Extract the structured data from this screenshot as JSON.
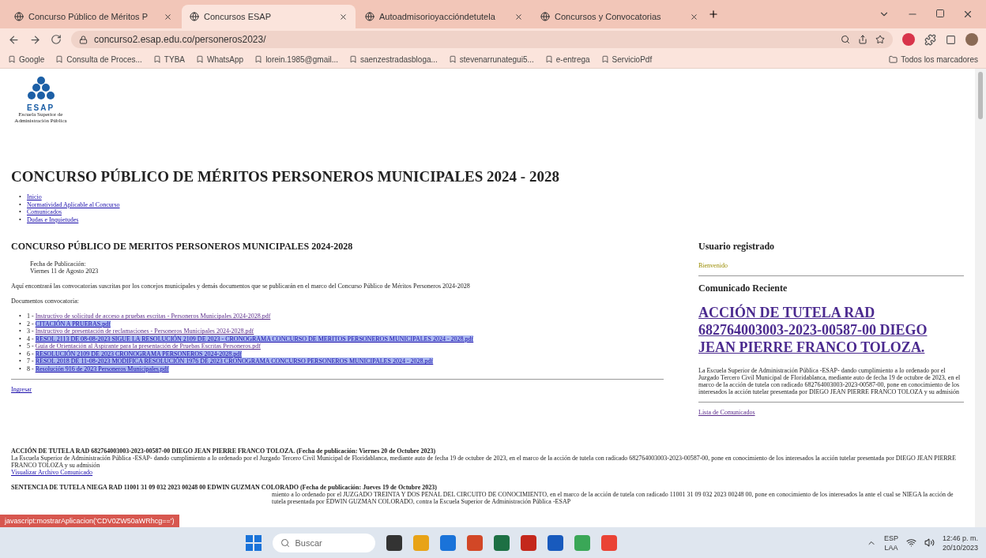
{
  "browser": {
    "tabs": [
      {
        "label": "Concurso Público de Méritos P",
        "selected": false
      },
      {
        "label": "Concursos ESAP",
        "selected": true
      },
      {
        "label": "Autoadmisorioyaccióndetutela",
        "selected": false
      },
      {
        "label": "Concursos y Convocatorias",
        "selected": false
      }
    ],
    "url": "concurso2.esap.edu.co/personeros2023/",
    "bookmarks": [
      "Google",
      "Consulta de Proces...",
      "TYBA",
      "WhatsApp",
      "lorein.1985@gmail...",
      "saenzestradasbloga...",
      "stevenarrunategui5...",
      "e-entrega",
      "ServicioPdf"
    ],
    "all_bookmarks": "Todos los marcadores",
    "status_url": "javascript:mostrarAplicacion('CDV0ZW50aWRhcg==')"
  },
  "logo": {
    "acronym": "ESAP",
    "name": "Escuela Superior de Administración Pública"
  },
  "page_title": "CONCURSO PÚBLICO DE MÉRITOS PERSONEROS MUNICIPALES 2024 - 2028",
  "list_marker": "•",
  "nav": [
    "Inicio",
    "Normatividad Aplicable al Concurso",
    "Comunicados",
    "Dudas e Inquietudes"
  ],
  "main": {
    "title": "CONCURSO PÚBLICO DE MERITOS PERSONEROS MUNICIPALES 2024-2028",
    "date_label": "Fecha de Publicación:",
    "date": "Viernes 11 de Agosto 2023",
    "intro": "Aquí encontrará las convocatorias suscritas por los concejos municipales y demás documentos que se publicarán en el marco del Concurso Público de Méritos Personeros 2024-2028",
    "docs_label": "Documentos convocatoria:",
    "documents": [
      {
        "number": "1 - ",
        "label": "Instructivo de solicitud de acceso a pruebas escritas - Personeros Municipales 2024-2028.pdf",
        "highlighted": false
      },
      {
        "number": "2 - ",
        "label": "CITACIÓN A PRUEBAS.pdf",
        "highlighted": true
      },
      {
        "number": "3 - ",
        "label": "Instructivo de presentación de reclamaciones - Personeros Municipales 2024-2028.pdf",
        "highlighted": false
      },
      {
        "number": "4 - ",
        "label": "RESOL 2113 DE 08-08-2023 SIGUE LA RESOLUCIÓN 2109 DE 2023 - CRONOGRAMA CONCURSO DE MERITOS PERSONEROS MUNICIPALES 2024 - 2028.pdf",
        "highlighted": true
      },
      {
        "number": "5 - ",
        "label": "Guía de Orientación al Aspirante para la presentación de Pruebas Escritas Personeros.pdf",
        "highlighted": false
      },
      {
        "number": "6 - ",
        "label": "RESOLUCIÓN 2109 DE 2023 CRONOGRAMA PERSONEROS 2024-2028.pdf",
        "highlighted": true
      },
      {
        "number": "7 - ",
        "label": "RESOL 2018 DE 11-08-2023 MODIFICA RESOLUCIÓN 1976 DE 2023 CRONOGRAMA CONCURSO PERSONEROS MUNICIPALES 2024 - 2028.pdf",
        "highlighted": true
      },
      {
        "number": "8 - ",
        "label": "Resolución 916 de 2023 Personeros Municipales.pdf",
        "highlighted": true
      }
    ],
    "login_link": "Ingresar"
  },
  "sidebar": {
    "user_title": "Usuario registrado",
    "user_status": "Bienvenido",
    "news_title": "Comunicado Reciente",
    "news_link": "ACCIÓN DE TUTELA RAD 682764003003-2023-00587-00 DIEGO JEAN PIERRE FRANCO TOLOZA.",
    "news_text": "La Escuela Superior de Administración Pública -ESAP- dando cumplimiento a lo ordenado por el Juzgado Tercero Civil Municipal de Floridablanca, mediante auto de fecha 19 de octubre de 2023, en el marco de la acción de tutela con radicado 682764003003-2023-00587-00, pone en conocimiento de los interesados la acción tutelar presentada por DIEGO JEAN PIERRE FRANCO TOLOZA y su admisión",
    "list_link": "Lista de Comunicados"
  },
  "announcements": [
    {
      "title": "ACCIÓN DE TUTELA RAD 682764003003-2023-00587-00 DIEGO JEAN PIERRE FRANCO TOLOZA. (Fecha de publicación: Viernes 20 de Octubre 2023)",
      "text": "La Escuela Superior de Administración Pública -ESAP- dando cumplimiento a lo ordenado por el Juzgado Tercero Civil Municipal de Floridablanca, mediante auto de fecha 19 de octubre de 2023, en el marco de la acción de tutela con radicado 682764003003-2023-00587-00, pone en conocimiento de los interesados la acción tutelar presentada por DIEGO JEAN PIERRE FRANCO TOLOZA y su admisión",
      "link": "Visualizar Archivo Comunicado"
    },
    {
      "title": "SENTENCIA DE TUTELA NIEGA RAD 11001 31 09 032 2023 00248 00 EDWIN GUZMAN COLORADO (Fecha de publicación: Jueves 19 de Octubre 2023)",
      "text": "miento a lo ordenado por el JUZGADO TREINTA Y DOS PENAL DEL CIRCUITO DE CONOCIMIENTO, en el marco de la acción de tutela con radicado 11001 31 09 032 2023 00248 00, pone en conocimiento de los interesados la ante el cual se NIEGA la acción de tutela presentada por EDWIN GUZMAN COLORADO, contra la Escuela Superior de Administración Pública -ESAP"
    }
  ],
  "taskbar": {
    "search": "Buscar",
    "language": "ESP",
    "layout": "LAA",
    "time": "12:46 p. m.",
    "date": "20/10/2023"
  }
}
